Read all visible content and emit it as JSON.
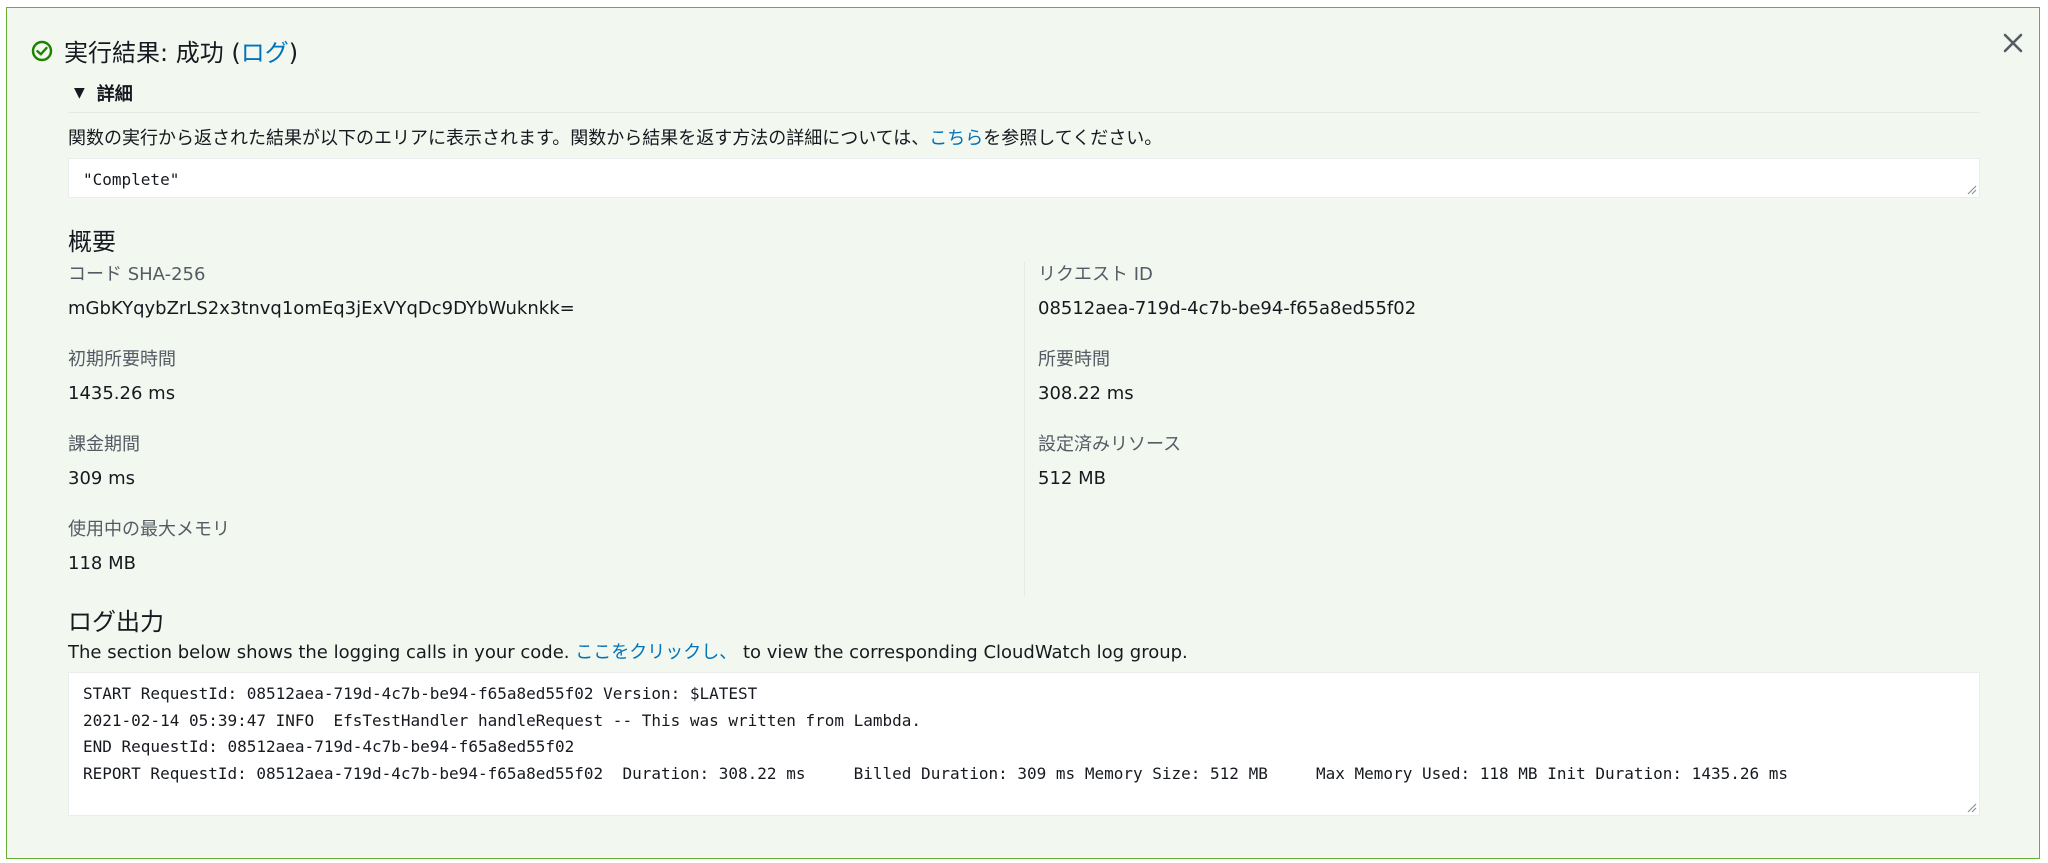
{
  "header": {
    "title_prefix": "実行結果: 成功 (",
    "title_link": "ログ",
    "title_suffix": ")",
    "status_color": "#1d8102",
    "close_icon": "close-icon",
    "status_icon": "check-circle-icon"
  },
  "details": {
    "toggle_label": "詳細",
    "description_prefix": "関数の実行から返された結果が以下のエリアに表示されます。関数から結果を返す方法の詳細については、",
    "description_link": "こちら",
    "description_suffix": "を参照してください。",
    "result_value": "\"Complete\""
  },
  "summary": {
    "heading": "概要",
    "left": [
      {
        "label": "コード SHA-256",
        "value": "mGbKYqybZrLS2x3tnvq1omEq3jExVYqDc9DYbWuknkk="
      },
      {
        "label": "初期所要時間",
        "value": "1435.26 ms"
      },
      {
        "label": "課金期間",
        "value": "309 ms"
      },
      {
        "label": "使用中の最大メモリ",
        "value": "118 MB"
      }
    ],
    "right": [
      {
        "label": "リクエスト ID",
        "value": "08512aea-719d-4c7b-be94-f65a8ed55f02"
      },
      {
        "label": "所要時間",
        "value": "308.22 ms"
      },
      {
        "label": "設定済みリソース",
        "value": "512 MB"
      }
    ]
  },
  "log_output": {
    "heading": "ログ出力",
    "desc_prefix": "The section below shows the logging calls in your code. ",
    "desc_link": "ここをクリックし、",
    "desc_suffix": " to view the corresponding CloudWatch log group.",
    "lines": [
      "START RequestId: 08512aea-719d-4c7b-be94-f65a8ed55f02 Version: $LATEST",
      "2021-02-14 05:39:47 INFO  EfsTestHandler handleRequest -- This was written from Lambda.",
      "END RequestId: 08512aea-719d-4c7b-be94-f65a8ed55f02",
      "REPORT RequestId: 08512aea-719d-4c7b-be94-f65a8ed55f02  Duration: 308.22 ms     Billed Duration: 309 ms Memory Size: 512 MB     Max Memory Used: 118 MB Init Duration: 1435.26 ms"
    ]
  }
}
